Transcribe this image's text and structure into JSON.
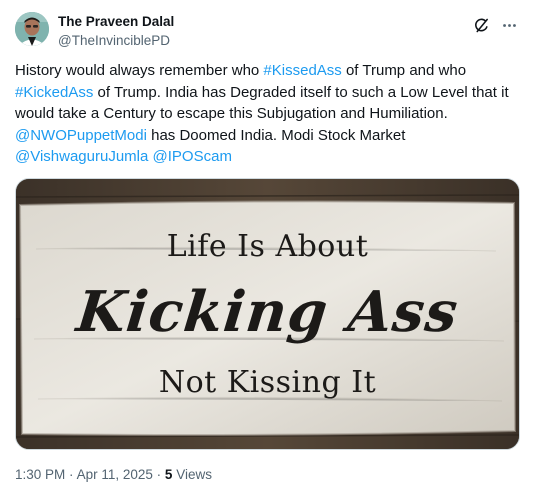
{
  "author": {
    "display_name": "The Praveen Dalal",
    "handle": "@TheInvinciblePD",
    "avatar_icon": "user-avatar-photo"
  },
  "header_actions": {
    "grok_icon": "grok-icon",
    "more_icon": "more-horizontal-icon"
  },
  "tweet": {
    "segments": [
      {
        "text": "History would always remember who ",
        "link": false
      },
      {
        "text": "#KissedAss",
        "link": true
      },
      {
        "text": " of Trump and who ",
        "link": false
      },
      {
        "text": "#KickedAss",
        "link": true
      },
      {
        "text": " of Trump. India has Degraded itself to such a Low Level that it would take a Century to escape this Subjugation and Humiliation. ",
        "link": false
      },
      {
        "text": "@NWOPuppetModi",
        "link": true
      },
      {
        "text": " has Doomed India. Modi Stock Market ",
        "link": false
      },
      {
        "text": "@VishwaguruJumla",
        "link": true
      },
      {
        "text": " ",
        "link": false
      },
      {
        "text": "@IPOScam",
        "link": true
      }
    ]
  },
  "media": {
    "line1": "Life Is About",
    "line2": "Kicking Ass",
    "line3": "Not Kissing It"
  },
  "meta": {
    "time": "1:30 PM",
    "separator": "·",
    "date": "Apr 11, 2025",
    "views_count": "5",
    "views_label": "Views"
  },
  "colors": {
    "link": "#1d9bf0",
    "text": "#0f1419",
    "secondary": "#536471",
    "border": "#cfd9de"
  }
}
